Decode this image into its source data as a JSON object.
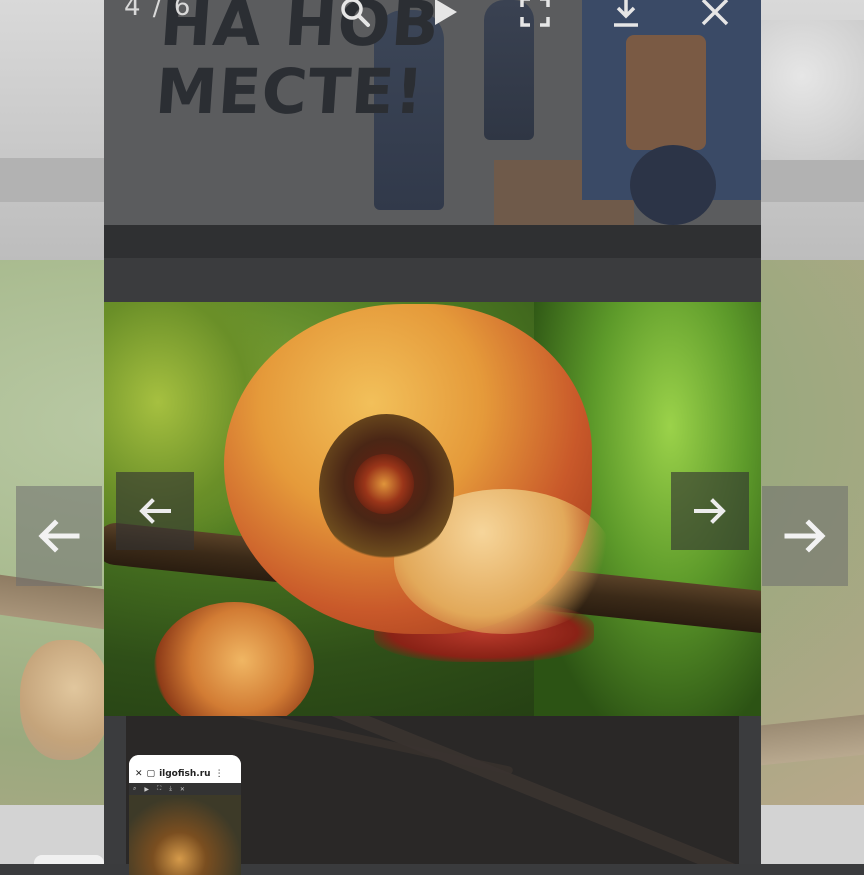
{
  "viewer": {
    "counter": "4 / 6",
    "poster_text": "НА НОВ\nМЕСТЕ!",
    "icons": {
      "zoom": "search-icon",
      "slideshow": "play-icon",
      "fullscreen": "fullscreen-icon",
      "download": "download-icon",
      "close": "close-icon",
      "prev": "arrow-left-icon",
      "next": "arrow-right-icon"
    },
    "colors": {
      "panel_bg": "#3b3c3e",
      "icon_color": "#e6e6e6",
      "nav_bg": "#323232"
    }
  },
  "thumbnail": {
    "site": "ilgofish.ru",
    "close_glyph": "✕",
    "menu_glyph": "⋮"
  }
}
